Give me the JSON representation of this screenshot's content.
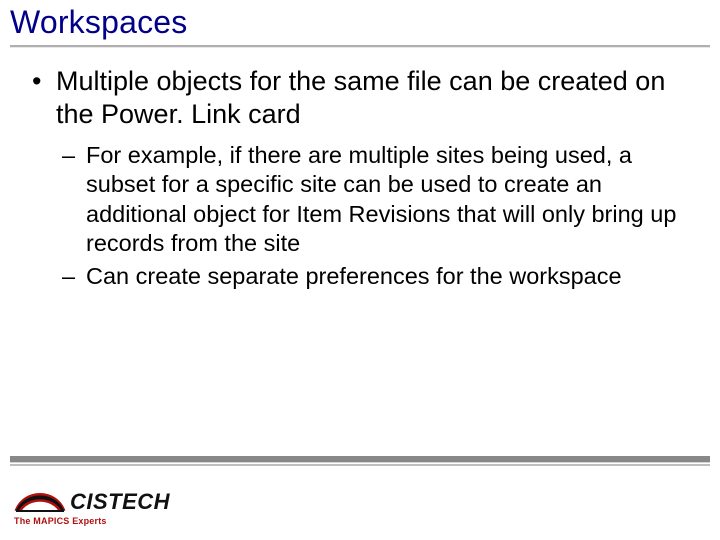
{
  "title": "Workspaces",
  "bullets": {
    "main": "Multiple objects for the same file can be created on the Power. Link card",
    "sub1": "For example, if there are multiple sites being used, a subset for a specific site can be used to create an additional object for Item Revisions that will only bring up records from the site",
    "sub2": "Can create separate preferences for the workspace"
  },
  "logo": {
    "name": "CISTECH",
    "tagline": "The MAPICS Experts"
  }
}
